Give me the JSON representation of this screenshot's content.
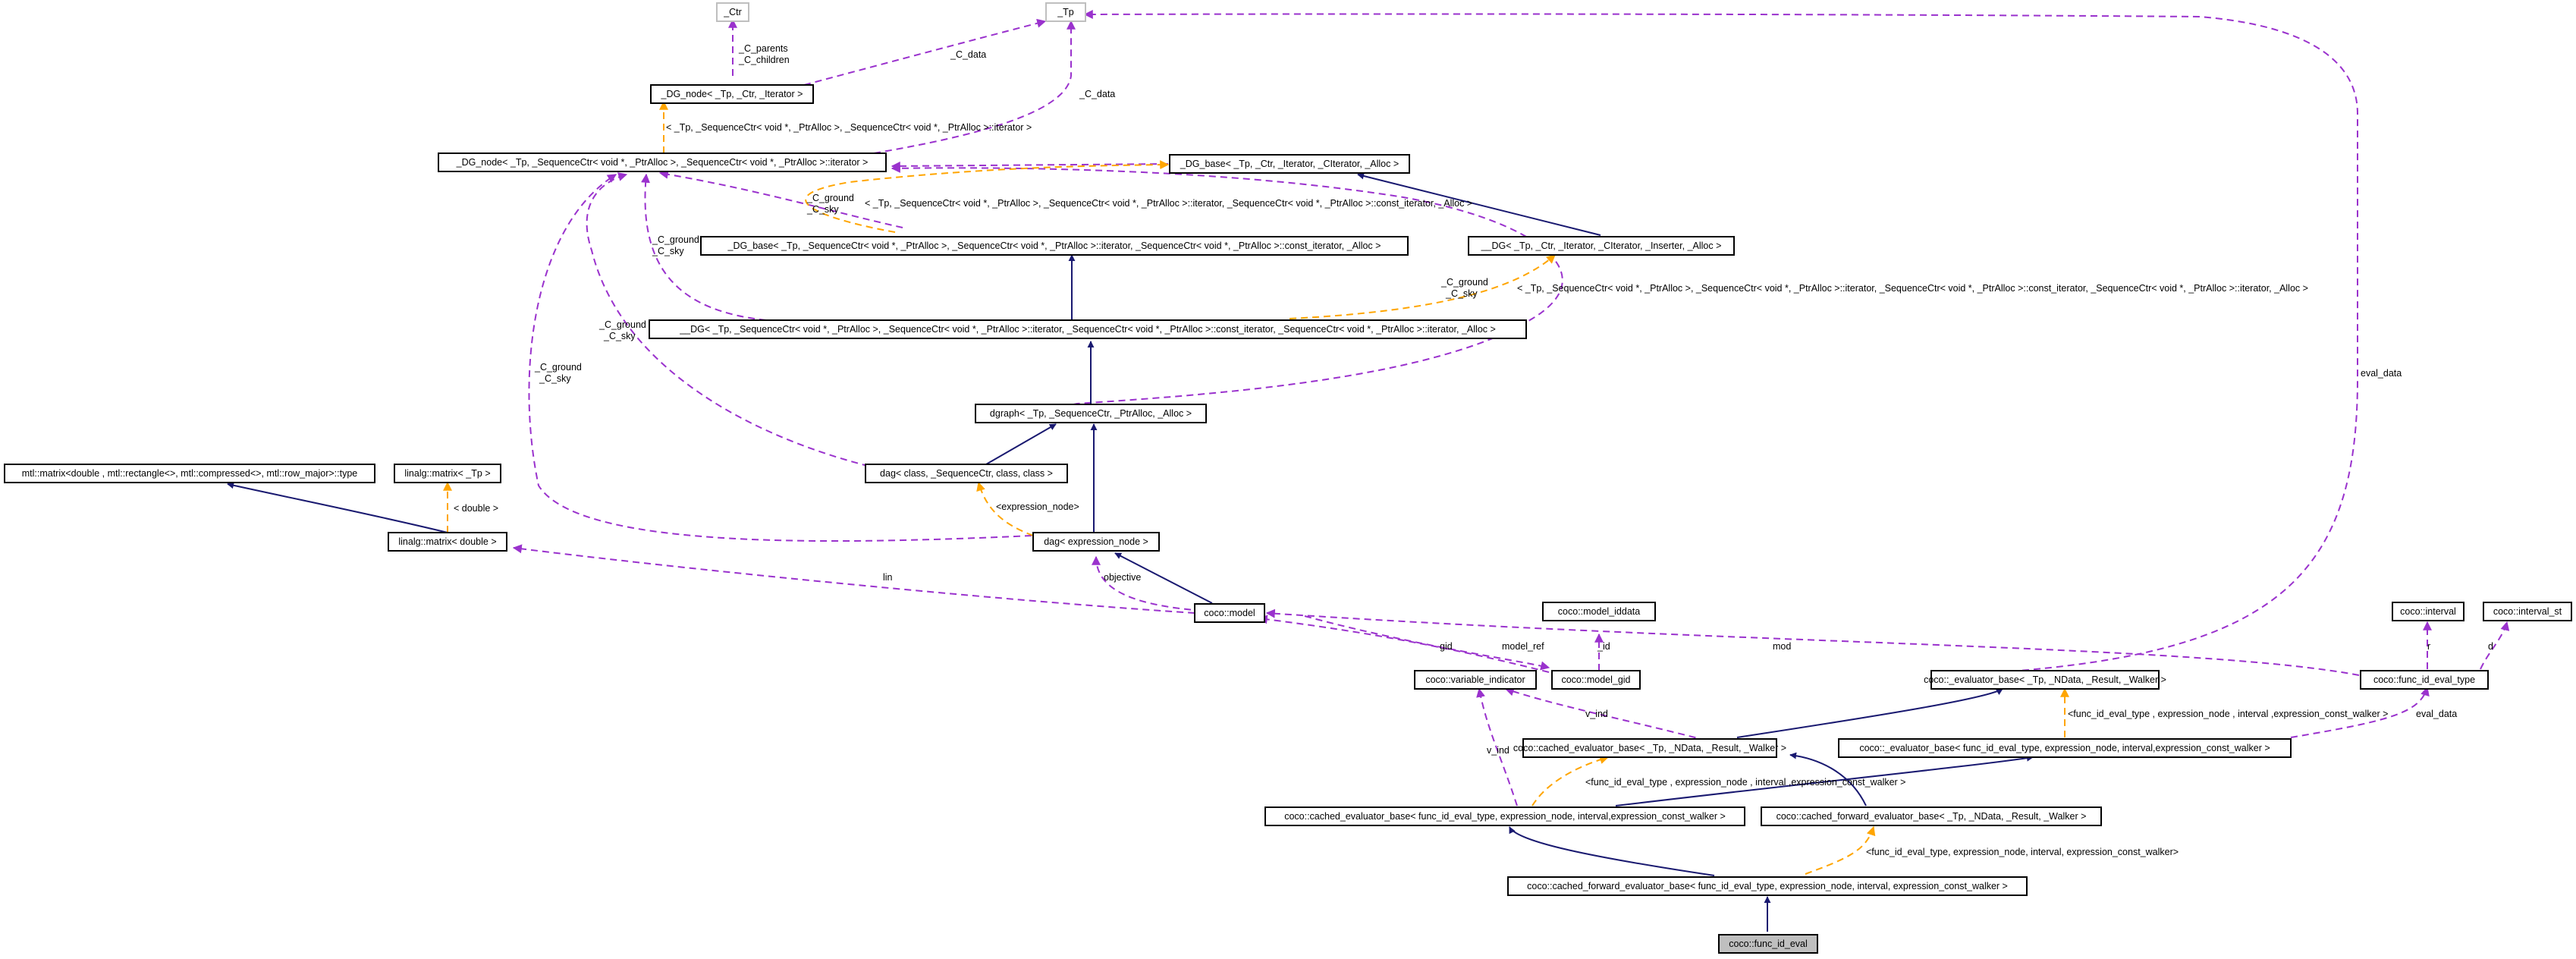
{
  "nodes": {
    "ctr": "_Ctr",
    "tp": "_Tp",
    "dg_node_generic": "_DG_node< _Tp, _Ctr, _Iterator >",
    "dg_node_inst": "_DG_node< _Tp, _SequenceCtr< void *, _PtrAlloc >, _SequenceCtr< void *, _PtrAlloc >::iterator >",
    "dg_base_generic": "_DG_base< _Tp, _Ctr, _Iterator, _CIterator, _Alloc >",
    "dg_base_inst": "_DG_base< _Tp, _SequenceCtr< void *, _PtrAlloc >, _SequenceCtr< void *, _PtrAlloc >::iterator, _SequenceCtr< void *, _PtrAlloc >::const_iterator, _Alloc >",
    "dg_generic": "__DG< _Tp, _Ctr, _Iterator, _CIterator, _Inserter, _Alloc >",
    "dg_inst": "__DG< _Tp, _SequenceCtr< void *, _PtrAlloc >, _SequenceCtr< void *, _PtrAlloc >::iterator, _SequenceCtr< void *, _PtrAlloc >::const_iterator, _SequenceCtr< void *, _PtrAlloc >::iterator, _Alloc >",
    "dgraph": "dgraph< _Tp, _SequenceCtr, _PtrAlloc, _Alloc >",
    "dag": "dag< class, _SequenceCtr, class, class >",
    "dag_expr": "dag< expression_node >",
    "mtl_matrix": "mtl::matrix<double , mtl::rectangle<>, mtl::compressed<>, mtl::row_major>::type",
    "linalg_tp": "linalg::matrix< _Tp >",
    "linalg_double": "linalg::matrix< double >",
    "model": "coco::model",
    "model_iddata": "coco::model_iddata",
    "model_gid": "coco::model_gid",
    "variable_indicator": "coco::variable_indicator",
    "interval": "coco::interval",
    "interval_st": "coco::interval_st",
    "evaluator_base_generic": "coco::_evaluator_base< _Tp, _NData, _Result, _Walker >",
    "func_id_eval_type": "coco::func_id_eval_type",
    "cached_evaluator_generic": "coco::cached_evaluator_base< _Tp, _NData, _Result, _Walker >",
    "evaluator_base_inst": "coco::_evaluator_base< func_id_eval_type, expression_node, interval,expression_const_walker >",
    "cached_evaluator_inst": "coco::cached_evaluator_base< func_id_eval_type, expression_node, interval,expression_const_walker >",
    "cached_forward_generic": "coco::cached_forward_evaluator_base< _Tp, _NData, _Result, _Walker >",
    "cached_forward_inst": "coco::cached_forward_evaluator_base< func_id_eval_type, expression_node, interval, expression_const_walker >",
    "func_id_eval": "coco::func_id_eval"
  },
  "edge_labels": {
    "c_data_1": "_C_data",
    "c_data_2": "_C_data",
    "c_parents": "_C_parents",
    "c_children": "_C_children",
    "tmpl_dg_node": "< _Tp, _SequenceCtr< void *, _PtrAlloc >, _SequenceCtr< void *, _PtrAlloc >::iterator >",
    "tmpl_dg_base": "< _Tp, _SequenceCtr< void *, _PtrAlloc >, _SequenceCtr< void *, _PtrAlloc >::iterator, _SequenceCtr< void *, _PtrAlloc >::const_iterator, _Alloc >",
    "tmpl_dg": "< _Tp, _SequenceCtr< void *, _PtrAlloc >, _SequenceCtr< void *, _PtrAlloc >::iterator, _SequenceCtr< void *, _PtrAlloc >::const_iterator, _SequenceCtr< void *, _PtrAlloc >::iterator, _Alloc >",
    "c_ground_1": "_C_ground",
    "c_sky_1": "_C_sky",
    "c_ground_2": "_C_ground",
    "c_sky_2": "_C_sky",
    "c_ground_3": "_C_ground",
    "c_sky_3": "_C_sky",
    "c_ground_4": "_C_ground",
    "c_sky_4": "_C_sky",
    "c_ground_5": "_C_ground",
    "c_sky_5": "_C_sky",
    "tmpl_expression_node": "<expression_node>",
    "tmpl_double": "< double >",
    "lin": "lin",
    "objective": "objective",
    "gid": "gid",
    "model_ref": "model_ref",
    "id": "_id",
    "mod": "mod",
    "eval_data_top": "eval_data",
    "eval_data_bottom": "eval_data",
    "r": "r",
    "d": "d",
    "v_ind_1": "v_ind",
    "v_ind_2": "v_ind",
    "tmpl_eval_base": "<func_id_eval_type , expression_node , interval ,expression_const_walker >",
    "tmpl_cached_eval": "<func_id_eval_type , expression_node , interval ,expression_const_walker >",
    "tmpl_cached_forward": "<func_id_eval_type, expression_node, interval, expression_const_walker>"
  }
}
